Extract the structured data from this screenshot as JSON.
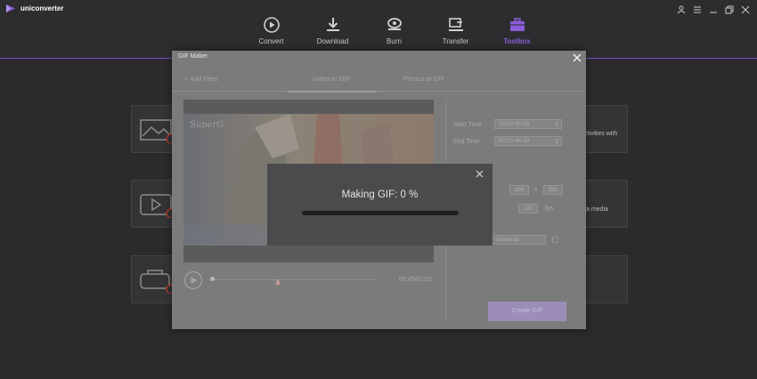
{
  "app": {
    "name": "uniconverter"
  },
  "nav": [
    {
      "label": "Convert",
      "icon": "convert-icon",
      "active": false
    },
    {
      "label": "Download",
      "icon": "download-icon",
      "active": false
    },
    {
      "label": "Burn",
      "icon": "burn-icon",
      "active": false
    },
    {
      "label": "Transfer",
      "icon": "transfer-icon",
      "active": false
    },
    {
      "label": "Toolbox",
      "icon": "toolbox-icon",
      "active": true
    }
  ],
  "background_cards": {
    "right_top_text_1": "activities with",
    "right_mid_text_1": "a media"
  },
  "dialog": {
    "title": "GIF Maker",
    "tabs": {
      "add_files": "+ Add Files",
      "video_to_gif": "Video to GIF",
      "photo_to_gif": "Photos to GIF"
    },
    "video": {
      "watermark_text": "SuperG",
      "timecode": "00:45/01:52",
      "progress_fraction": 0.004
    },
    "settings": {
      "start_time_label": "Start Time",
      "start_time_value": "00:00:45.00",
      "end_time_label": "End Time",
      "end_time_value": "00:00:46.00",
      "width_value": "300",
      "size_separator": "x",
      "height_value": "281",
      "fps_value": "29",
      "fps_unit": "fps",
      "output_path": "~\\Desktop"
    },
    "create_button": "Create GIF"
  },
  "progress": {
    "title": "Making GIF: 0 %",
    "percent": 0
  },
  "colors": {
    "accent": "#8a5cd6",
    "background": "#2b2b2d",
    "dialog": "#7b7b7c",
    "modal": "#4b4b4d"
  }
}
